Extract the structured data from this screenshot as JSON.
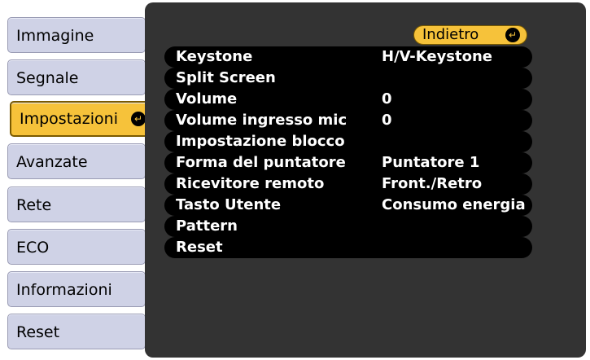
{
  "sidebar": {
    "items": [
      {
        "label": "Immagine"
      },
      {
        "label": "Segnale"
      },
      {
        "label": "Impostazioni",
        "active": true
      },
      {
        "label": "Avanzate"
      },
      {
        "label": "Rete"
      },
      {
        "label": "ECO"
      },
      {
        "label": "Informazioni"
      },
      {
        "label": "Reset"
      }
    ]
  },
  "main": {
    "back_label": "Indietro",
    "rows": [
      {
        "label": "Keystone",
        "value": "H/V-Keystone"
      },
      {
        "label": "Split Screen",
        "value": ""
      },
      {
        "label": "Volume",
        "value": "0"
      },
      {
        "label": "Volume ingresso mic",
        "value": "0"
      },
      {
        "label": "Impostazione blocco",
        "value": ""
      },
      {
        "label": "Forma del puntatore",
        "value": "Puntatore 1"
      },
      {
        "label": "Ricevitore remoto",
        "value": "Front./Retro"
      },
      {
        "label": "Tasto Utente",
        "value": "Consumo energia"
      },
      {
        "label": "Pattern",
        "value": ""
      },
      {
        "label": "Reset",
        "value": ""
      }
    ]
  },
  "colors": {
    "accent": "#f6c23a",
    "tab": "#cfd2e6",
    "panel": "#333333",
    "row": "#000000"
  },
  "icons": {
    "enter": "enter-icon"
  }
}
